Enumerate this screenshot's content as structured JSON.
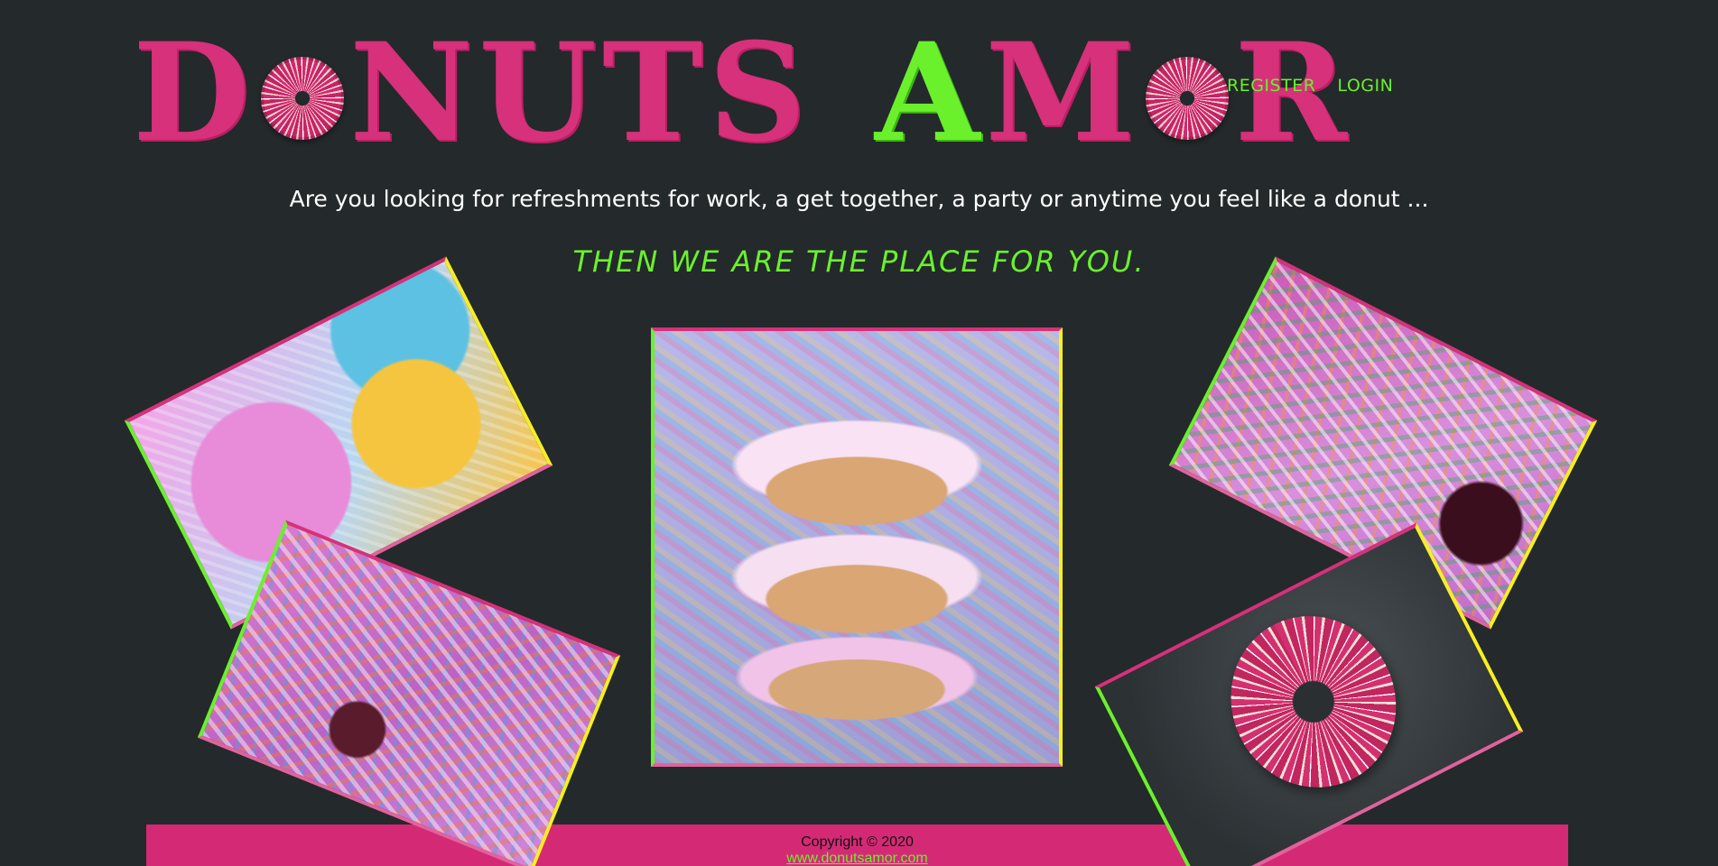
{
  "brand": {
    "logo_left": [
      "D",
      "NUTS"
    ],
    "logo_right": [
      "A",
      "M",
      "R"
    ],
    "logo_text": "DONUTS AMOR"
  },
  "nav": {
    "register": "REGISTER",
    "login": "LOGIN"
  },
  "intro": {
    "text": "Are you looking for refreshments for work, a get together, a party or anytime you feel like a donut ...",
    "tagline": "THEN WE ARE THE PLACE FOR YOU."
  },
  "footer": {
    "copyright": "Copyright © 2020",
    "website": "www.donutsamor.com"
  },
  "colors": {
    "background": "#24292b",
    "brand_pink": "#d6317a",
    "accent_green": "#6af12c",
    "accent_yellow": "#f6ef22",
    "footer_bg": "#d42a75"
  }
}
